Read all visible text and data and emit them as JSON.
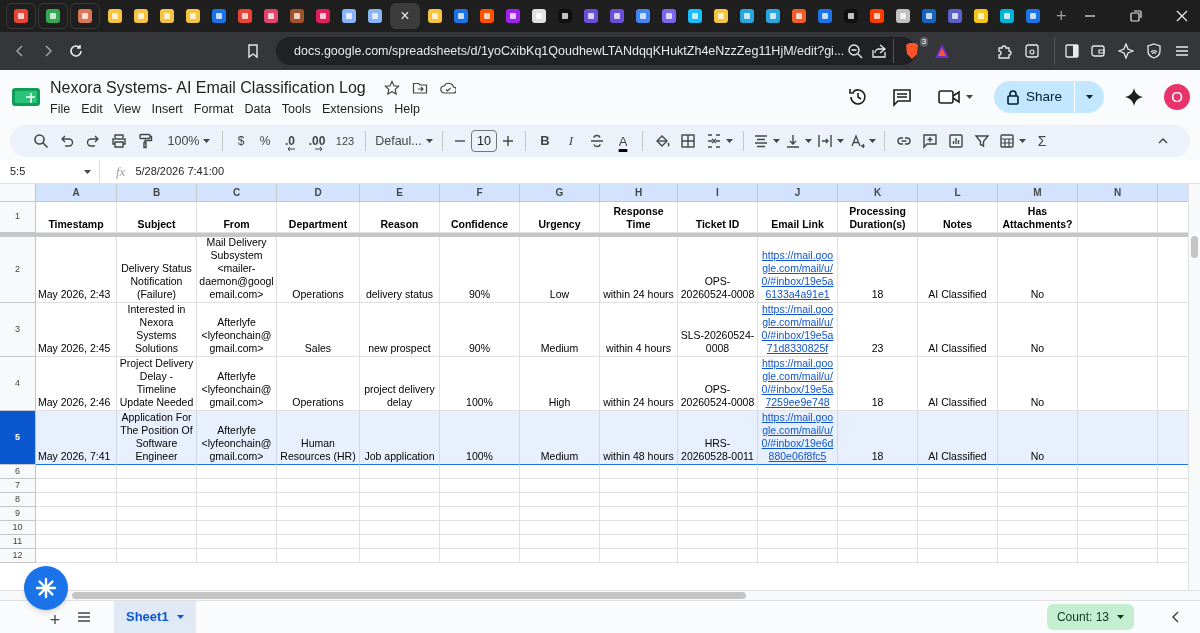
{
  "browser": {
    "tabs": [
      {
        "selected": false
      },
      {
        "selected": false
      },
      {
        "selected": false
      },
      {
        "selected": false
      },
      {
        "selected": false
      },
      {
        "selected": false
      },
      {
        "selected": false
      },
      {
        "selected": false
      },
      {
        "selected": false
      },
      {
        "selected": false
      },
      {
        "selected": false
      },
      {
        "selected": false
      },
      {
        "selected": false
      },
      {
        "selected": false
      },
      {
        "selected": true,
        "close": "×"
      },
      {
        "selected": false
      },
      {
        "selected": false
      },
      {
        "selected": false
      },
      {
        "selected": false
      },
      {
        "selected": false
      },
      {
        "selected": false
      },
      {
        "selected": false
      },
      {
        "selected": false
      },
      {
        "selected": false
      },
      {
        "selected": false
      },
      {
        "selected": false
      },
      {
        "selected": false
      },
      {
        "selected": false
      },
      {
        "selected": false
      },
      {
        "selected": false
      },
      {
        "selected": false
      },
      {
        "selected": false
      },
      {
        "selected": false
      },
      {
        "selected": false
      },
      {
        "selected": false
      },
      {
        "selected": false
      },
      {
        "selected": false
      },
      {
        "selected": false
      },
      {
        "selected": false
      }
    ],
    "new_tab": "+"
  },
  "address_bar": {
    "url": "docs.google.com/spreadsheets/d/1yoCxibKq1QoudhewLTANdqqKHuktZh4eNzzZeg11HjM/edit?gi...",
    "shields_count": "3"
  },
  "document": {
    "title": "Nexora Systems- AI Email Classification Log",
    "menu": [
      "File",
      "Edit",
      "View",
      "Insert",
      "Format",
      "Data",
      "Tools",
      "Extensions",
      "Help"
    ],
    "share": "Share",
    "avatar": "O"
  },
  "toolbar": {
    "zoom": "100%",
    "currency": "$",
    "percent": "%",
    "decrease_decimals": ".0",
    "increase_decimals": ".00",
    "number_format": "123",
    "font": "Defaul...",
    "font_size": "10",
    "bold": "B",
    "italic": "I",
    "text_color": "A",
    "functions": "Σ"
  },
  "formula_bar": {
    "cell_ref": "5:5",
    "fx": "fx",
    "value": "5/28/2026 7:41:00"
  },
  "sheet": {
    "columns": [
      {
        "letter": "A",
        "kind": "date"
      },
      {
        "letter": "B",
        "kind": "text"
      },
      {
        "letter": "C",
        "kind": "text"
      },
      {
        "letter": "D",
        "kind": "text"
      },
      {
        "letter": "E",
        "kind": "text"
      },
      {
        "letter": "F",
        "kind": "text"
      },
      {
        "letter": "G",
        "kind": "text"
      },
      {
        "letter": "H",
        "kind": "text"
      },
      {
        "letter": "I",
        "kind": "text"
      },
      {
        "letter": "J",
        "kind": "link"
      },
      {
        "letter": "K",
        "kind": "text"
      },
      {
        "letter": "L",
        "kind": "text"
      },
      {
        "letter": "M",
        "kind": "text"
      },
      {
        "letter": "N",
        "kind": "text"
      }
    ],
    "rows": [
      {
        "number": "1",
        "kind": "header",
        "selected": false,
        "cells": [
          "Timestamp",
          "Subject",
          "From",
          "Department",
          "Reason",
          "Confidence",
          "Urgency",
          "Response Time",
          "Ticket ID",
          "Email Link",
          "Processing Duration(s)",
          "Notes",
          "Has Attachments?"
        ]
      },
      {
        "number": "2",
        "kind": "data",
        "selected": false,
        "cells": [
          "May 2026, 2:43",
          "Delivery Status Notification (Failure)",
          "Mail Delivery Subsystem <mailer-daemon@googlemail.com>",
          "Operations",
          "delivery status",
          "90%",
          "Low",
          "within 24 hours",
          "OPS-20260524-0008",
          "https://mail.google.com/mail/u/0/#inbox/19e5a6133a4a91e1",
          "18",
          "AI Classified",
          "No"
        ]
      },
      {
        "number": "3",
        "kind": "data",
        "selected": false,
        "cells": [
          "May 2026, 2:45",
          "Interested in Nexora Systems Solutions",
          "Afterlyfe <lyfeonchain@gmail.com>",
          "Sales",
          "new prospect",
          "90%",
          "Medium",
          "within 4 hours",
          "SLS-20260524-0008",
          "https://mail.google.com/mail/u/0/#inbox/19e5a71d8330825f",
          "23",
          "AI Classified",
          "No"
        ]
      },
      {
        "number": "4",
        "kind": "data",
        "selected": false,
        "cells": [
          "May 2026, 2:46",
          "Project Delivery Delay - Timeline Update Needed",
          "Afterlyfe <lyfeonchain@gmail.com>",
          "Operations",
          "project delivery delay",
          "100%",
          "High",
          "within 24 hours",
          "OPS-20260524-0008",
          "https://mail.google.com/mail/u/0/#inbox/19e5a7259ee9e748",
          "18",
          "AI Classified",
          "No"
        ]
      },
      {
        "number": "5",
        "kind": "data",
        "selected": true,
        "cells": [
          "May 2026, 7:41",
          "Application For The Position Of Software Engineer",
          "Afterlyfe <lyfeonchain@gmail.com>",
          "Human Resources (HR)",
          "Job application",
          "100%",
          "Medium",
          "within 48 hours",
          "HRS-20260528-0011",
          "https://mail.google.com/mail/u/0/#inbox/19e6d880e06f8fc5",
          "18",
          "AI Classified",
          "No"
        ]
      }
    ],
    "empty_rows": [
      "6",
      "7",
      "8",
      "9",
      "10",
      "11",
      "12"
    ]
  },
  "bottom_bar": {
    "add": "+",
    "sheets": [
      {
        "label": "Sheet1",
        "selected": true
      }
    ],
    "count": "Count: 13"
  }
}
